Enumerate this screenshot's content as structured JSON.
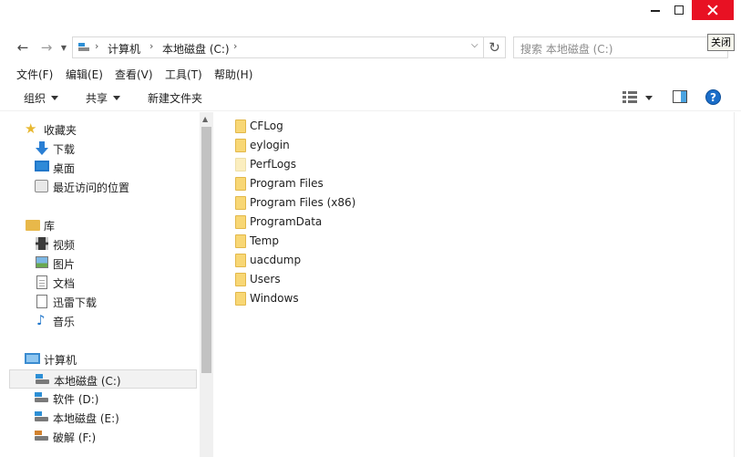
{
  "window": {
    "tooltip": "关闭"
  },
  "nav": {
    "breadcrumb": [
      "计算机",
      "本地磁盘 (C:)"
    ],
    "search_placeholder": "搜索 本地磁盘 (C:)"
  },
  "menu": [
    "文件(F)",
    "编辑(E)",
    "查看(V)",
    "工具(T)",
    "帮助(H)"
  ],
  "toolbar": {
    "organize": "组织",
    "share": "共享",
    "new_folder": "新建文件夹"
  },
  "sidebar": {
    "favorites": {
      "label": "收藏夹",
      "items": [
        "下载",
        "桌面",
        "最近访问的位置"
      ]
    },
    "libraries": {
      "label": "库",
      "items": [
        "视频",
        "图片",
        "文档",
        "迅雷下载",
        "音乐"
      ]
    },
    "computer": {
      "label": "计算机",
      "items": [
        "本地磁盘 (C:)",
        "软件 (D:)",
        "本地磁盘 (E:)",
        "破解 (F:)"
      ]
    }
  },
  "files": [
    "CFLog",
    "eylogin",
    "PerfLogs",
    "Program Files",
    "Program Files (x86)",
    "ProgramData",
    "Temp",
    "uacdump",
    "Users",
    "Windows"
  ]
}
